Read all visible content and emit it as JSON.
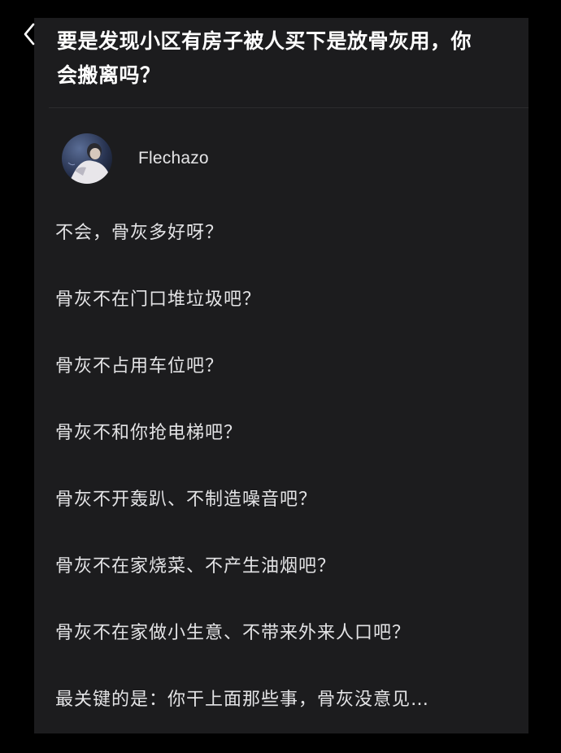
{
  "header": {
    "back_icon": "chevron-left-icon",
    "question_title": "要是发现小区有房子被人买下是放骨灰用，你会搬离吗？"
  },
  "author": {
    "avatar_icon": "avatar-photo",
    "name": "Flechazo"
  },
  "answer": {
    "paragraphs": [
      "不会，骨灰多好呀？",
      "骨灰不在门口堆垃圾吧？",
      "骨灰不占用车位吧？",
      "骨灰不和你抢电梯吧？",
      "骨灰不开轰趴、不制造噪音吧？",
      "骨灰不在家烧菜、不产生油烟吧？",
      "骨灰不在家做小生意、不带来外来人口吧？",
      "最关键的是：你干上面那些事，骨灰没意见…"
    ]
  },
  "colors": {
    "page_background": "#000000",
    "card_background": "#1c1c1e",
    "title_text": "#ffffff",
    "body_text": "#e3e3e5"
  }
}
